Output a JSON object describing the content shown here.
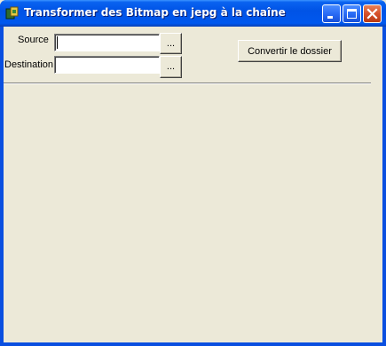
{
  "window": {
    "title": "Transformer des Bitmap en jepg  à la chaîne",
    "icon": "app-icon",
    "controls": {
      "minimize": "minimize-icon",
      "maximize": "maximize-icon",
      "close": "close-icon"
    }
  },
  "form": {
    "source_label": "Source",
    "source_value": "",
    "destination_label": "Destination",
    "destination_value": "",
    "browse_label": "...",
    "convert_label": "Convertir le dossier"
  },
  "colors": {
    "titlebar": "#0058ee",
    "client": "#ece9d8",
    "close_button": "#d6502a"
  }
}
